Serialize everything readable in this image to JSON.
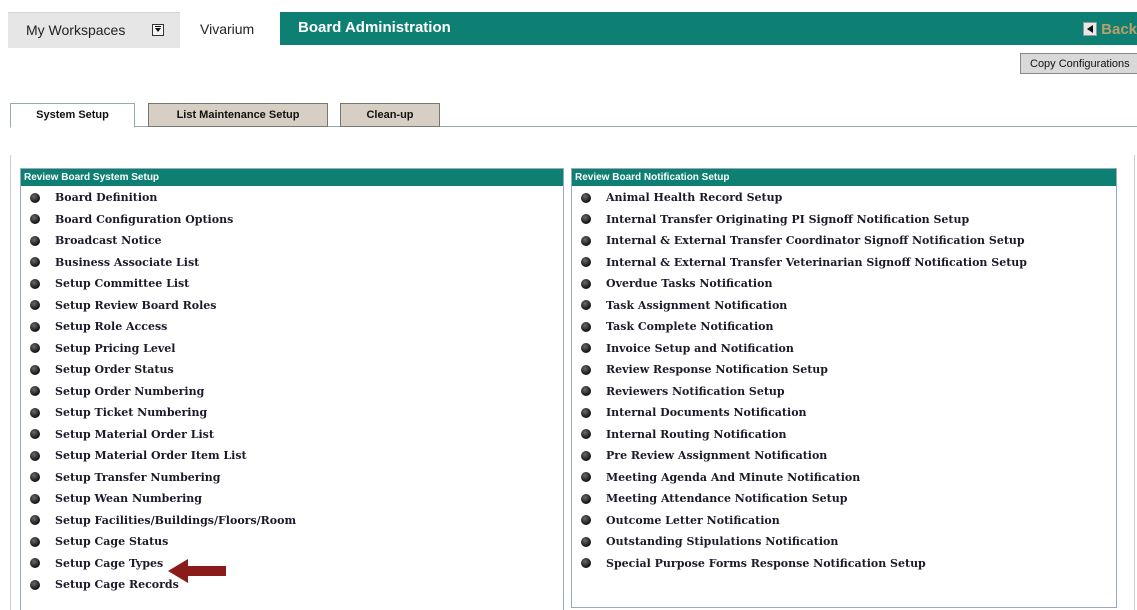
{
  "topbar": {
    "workspace_label": "My Workspaces",
    "vivarium_label": "Vivarium",
    "board_title": "Board Administration",
    "back_label": "Back",
    "brand_color": "#0e7f73"
  },
  "copy_button": "Copy Configurations",
  "tabs": [
    {
      "label": "System Setup",
      "active": true
    },
    {
      "label": "List Maintenance Setup",
      "active": false
    },
    {
      "label": "Clean-up",
      "active": false
    }
  ],
  "left_panel": {
    "title": "Review Board System Setup",
    "items": [
      "Board Definition",
      "Board Configuration Options",
      "Broadcast Notice",
      "Business Associate List",
      "Setup Committee List",
      "Setup Review Board Roles",
      "Setup Role Access",
      "Setup Pricing Level",
      "Setup Order Status",
      "Setup Order Numbering",
      "Setup Ticket Numbering",
      "Setup Material Order List",
      "Setup Material Order Item List",
      "Setup Transfer Numbering",
      "Setup Wean Numbering",
      "Setup Facilities/Buildings/Floors/Room",
      "Setup Cage Status",
      "Setup Cage Types",
      "Setup Cage Records"
    ]
  },
  "right_panel": {
    "title": "Review Board  Notification Setup",
    "items": [
      "Animal Health Record Setup",
      "Internal Transfer Originating PI Signoff Notification Setup",
      "Internal & External Transfer Coordinator Signoff Notification Setup",
      "Internal & External Transfer Veterinarian Signoff Notification Setup",
      "Overdue Tasks Notification",
      "Task Assignment Notification",
      "Task Complete Notification",
      "Invoice Setup and Notification",
      "Review Response Notification Setup",
      "Reviewers Notification Setup",
      "Internal Documents Notification",
      "Internal Routing Notification",
      "Pre Review Assignment Notification",
      "Meeting Agenda And Minute Notification",
      "Meeting Attendance Notification Setup",
      "Outcome Letter Notification",
      "Outstanding Stipulations Notification",
      "Special Purpose Forms Response Notification Setup"
    ]
  },
  "arrow_color": "#8b1a1a"
}
